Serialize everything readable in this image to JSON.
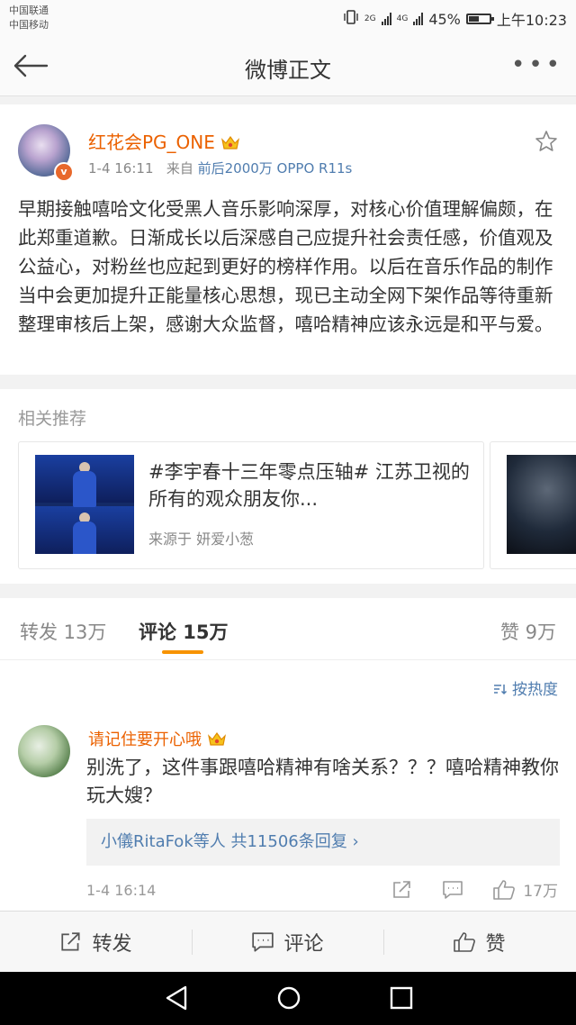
{
  "status_bar": {
    "carrier1": "中国联通",
    "carrier2": "中国移动",
    "network1": "2G",
    "network2": "4G",
    "battery": "45%",
    "time": "上午10:23"
  },
  "nav": {
    "title": "微博正文"
  },
  "post": {
    "username": "红花会PG_ONE",
    "date": "1-4 16:11",
    "source_prefix": "来自",
    "source": "前后2000万 OPPO R11s",
    "text": "早期接触嘻哈文化受黑人音乐影响深厚，对核心价值理解偏颇，在此郑重道歉。日渐成长以后深感自己应提升社会责任感，价值观及公益心，对粉丝也应起到更好的榜样作用。以后在音乐作品的制作当中会更加提升正能量核心思想，现已主动全网下架作品等待重新整理审核后上架，感谢大众监督，嘻哈精神应该永远是和平与爱。"
  },
  "recommend": {
    "title": "相关推荐",
    "card_title": "#李宇春十三年零点压轴# 江苏卫视的所有的观众朋友你...",
    "card_source": "来源于 妍爱小葱"
  },
  "tabs": {
    "repost": "转发 13万",
    "comment": "评论 15万",
    "like": "赞 9万"
  },
  "comments": {
    "sort_label": "按热度",
    "items": [
      {
        "name": "请记住要开心哦",
        "text": "别洗了，这件事跟嘻哈精神有啥关系？？？嘻哈精神教你玩大嫂？",
        "replies": "小儀RitaFok等人 共11506条回复 ›",
        "time": "1-4 16:14",
        "likes": "17万"
      }
    ]
  },
  "bottom_bar": {
    "repost": "转发",
    "comment": "评论",
    "like": "赞"
  },
  "colors": {
    "accent_orange": "#eb6100",
    "link_blue": "#507daf",
    "tab_indicator": "#f79300"
  }
}
